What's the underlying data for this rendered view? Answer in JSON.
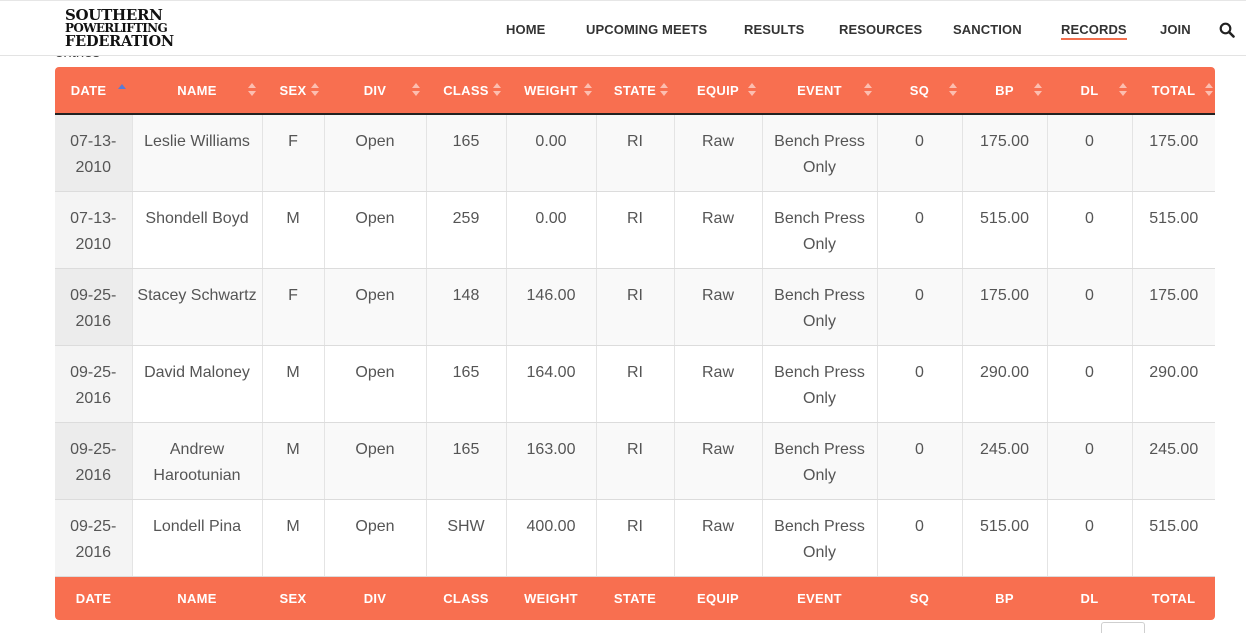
{
  "brand": {
    "line1": "SOUTHERN",
    "line2": "POWERLIFTING",
    "line3": "FEDERATION"
  },
  "nav": {
    "items": [
      {
        "label": "HOME"
      },
      {
        "label": "UPCOMING MEETS"
      },
      {
        "label": "RESULTS"
      },
      {
        "label": "RESOURCES"
      },
      {
        "label": "SANCTION"
      },
      {
        "label": "RECORDS",
        "active": true
      },
      {
        "label": "JOIN"
      }
    ],
    "search_icon": "search-icon"
  },
  "entries_peek": "entries",
  "table": {
    "columns": [
      "DATE",
      "NAME",
      "SEX",
      "DIV",
      "CLASS",
      "WEIGHT",
      "STATE",
      "EQUIP",
      "EVENT",
      "SQ",
      "BP",
      "DL",
      "TOTAL"
    ],
    "sorted_column": "DATE",
    "rows": [
      [
        "07-13-2010",
        "Leslie Williams",
        "F",
        "Open",
        "165",
        "0.00",
        "RI",
        "Raw",
        "Bench Press Only",
        "0",
        "175.00",
        "0",
        "175.00"
      ],
      [
        "07-13-2010",
        "Shondell Boyd",
        "M",
        "Open",
        "259",
        "0.00",
        "RI",
        "Raw",
        "Bench Press Only",
        "0",
        "515.00",
        "0",
        "515.00"
      ],
      [
        "09-25-2016",
        "Stacey Schwartz",
        "F",
        "Open",
        "148",
        "146.00",
        "RI",
        "Raw",
        "Bench Press Only",
        "0",
        "175.00",
        "0",
        "175.00"
      ],
      [
        "09-25-2016",
        "David Maloney",
        "M",
        "Open",
        "165",
        "164.00",
        "RI",
        "Raw",
        "Bench Press Only",
        "0",
        "290.00",
        "0",
        "290.00"
      ],
      [
        "09-25-2016",
        "Andrew Harootunian",
        "M",
        "Open",
        "165",
        "163.00",
        "RI",
        "Raw",
        "Bench Press Only",
        "0",
        "245.00",
        "0",
        "245.00"
      ],
      [
        "09-25-2016",
        "Londell Pina",
        "M",
        "Open",
        "SHW",
        "400.00",
        "RI",
        "Raw",
        "Bench Press Only",
        "0",
        "515.00",
        "0",
        "515.00"
      ]
    ]
  },
  "colors": {
    "accent": "#f86f50",
    "sort_active": "#5b7bd5"
  }
}
